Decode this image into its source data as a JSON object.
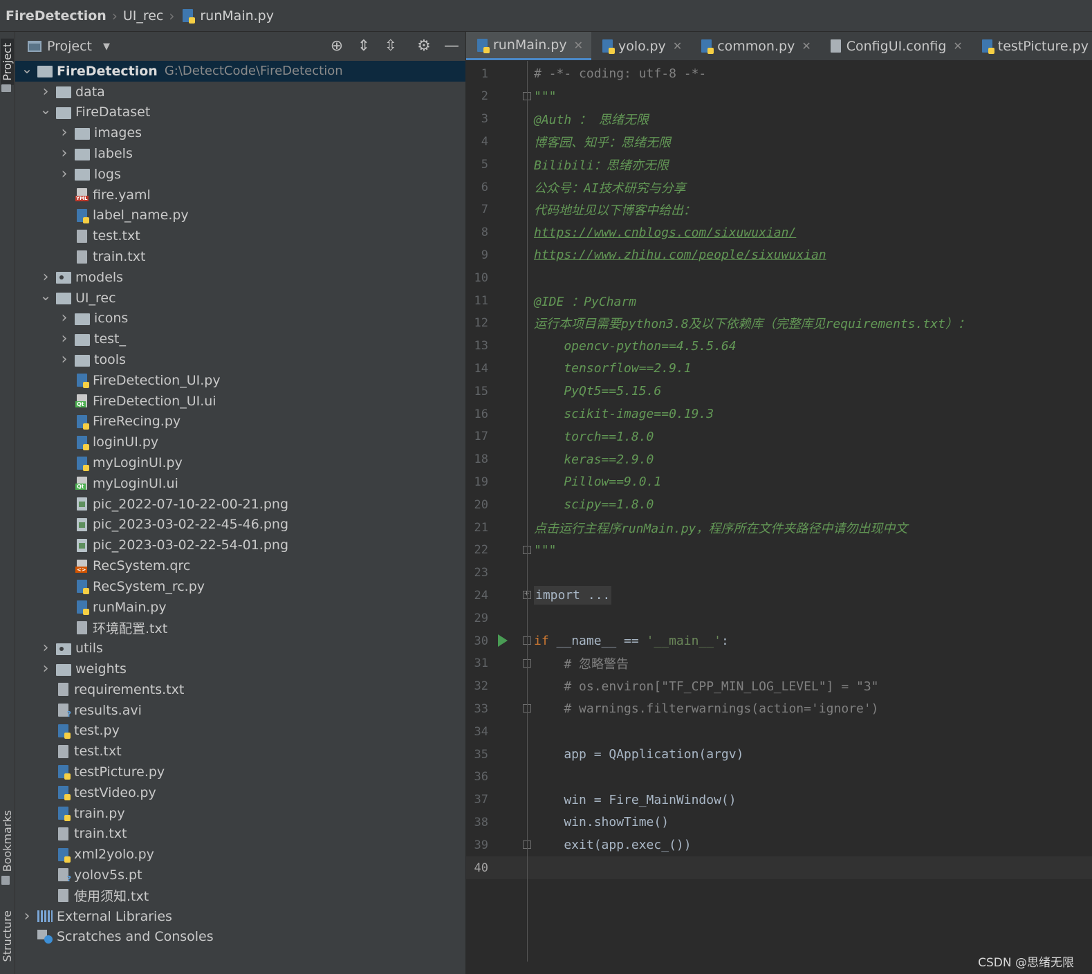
{
  "breadcrumb": {
    "root": "FireDetection",
    "folder": "UI_rec",
    "file": "runMain.py"
  },
  "side_labels": {
    "project": "Project",
    "bookmarks": "Bookmarks",
    "structure": "Structure"
  },
  "project_panel": {
    "title": "Project"
  },
  "tree": [
    {
      "label": "FireDetection",
      "path": "G:\\DetectCode\\FireDetection",
      "depth": 0,
      "kind": "folder",
      "arrow": "open",
      "selected": true,
      "bold": true
    },
    {
      "label": "data",
      "depth": 1,
      "kind": "folder",
      "arrow": "closed"
    },
    {
      "label": "FireDataset",
      "depth": 1,
      "kind": "folder",
      "arrow": "open"
    },
    {
      "label": "images",
      "depth": 2,
      "kind": "folder",
      "arrow": "closed"
    },
    {
      "label": "labels",
      "depth": 2,
      "kind": "folder",
      "arrow": "closed"
    },
    {
      "label": "logs",
      "depth": 2,
      "kind": "folder",
      "arrow": "closed"
    },
    {
      "label": "fire.yaml",
      "depth": 2,
      "kind": "yml"
    },
    {
      "label": "label_name.py",
      "depth": 2,
      "kind": "py"
    },
    {
      "label": "test.txt",
      "depth": 2,
      "kind": "txt"
    },
    {
      "label": "train.txt",
      "depth": 2,
      "kind": "txt"
    },
    {
      "label": "models",
      "depth": 1,
      "kind": "folder-dot",
      "arrow": "closed"
    },
    {
      "label": "UI_rec",
      "depth": 1,
      "kind": "folder",
      "arrow": "open"
    },
    {
      "label": "icons",
      "depth": 2,
      "kind": "folder",
      "arrow": "closed"
    },
    {
      "label": "test_",
      "depth": 2,
      "kind": "folder",
      "arrow": "closed"
    },
    {
      "label": "tools",
      "depth": 2,
      "kind": "folder",
      "arrow": "closed"
    },
    {
      "label": "FireDetection_UI.py",
      "depth": 2,
      "kind": "py"
    },
    {
      "label": "FireDetection_UI.ui",
      "depth": 2,
      "kind": "ui"
    },
    {
      "label": "FireRecing.py",
      "depth": 2,
      "kind": "py"
    },
    {
      "label": "loginUI.py",
      "depth": 2,
      "kind": "py"
    },
    {
      "label": "myLoginUI.py",
      "depth": 2,
      "kind": "py"
    },
    {
      "label": "myLoginUI.ui",
      "depth": 2,
      "kind": "ui"
    },
    {
      "label": "pic_2022-07-10-22-00-21.png",
      "depth": 2,
      "kind": "img"
    },
    {
      "label": "pic_2023-03-02-22-45-46.png",
      "depth": 2,
      "kind": "img"
    },
    {
      "label": "pic_2023-03-02-22-54-01.png",
      "depth": 2,
      "kind": "img"
    },
    {
      "label": "RecSystem.qrc",
      "depth": 2,
      "kind": "qrc"
    },
    {
      "label": "RecSystem_rc.py",
      "depth": 2,
      "kind": "py"
    },
    {
      "label": "runMain.py",
      "depth": 2,
      "kind": "py"
    },
    {
      "label": "环境配置.txt",
      "depth": 2,
      "kind": "txt"
    },
    {
      "label": "utils",
      "depth": 1,
      "kind": "folder-dot",
      "arrow": "closed"
    },
    {
      "label": "weights",
      "depth": 1,
      "kind": "folder",
      "arrow": "closed"
    },
    {
      "label": "requirements.txt",
      "depth": 1,
      "kind": "txt"
    },
    {
      "label": "results.avi",
      "depth": 1,
      "kind": "unk"
    },
    {
      "label": "test.py",
      "depth": 1,
      "kind": "py"
    },
    {
      "label": "test.txt",
      "depth": 1,
      "kind": "txt"
    },
    {
      "label": "testPicture.py",
      "depth": 1,
      "kind": "py"
    },
    {
      "label": "testVideo.py",
      "depth": 1,
      "kind": "py"
    },
    {
      "label": "train.py",
      "depth": 1,
      "kind": "py"
    },
    {
      "label": "train.txt",
      "depth": 1,
      "kind": "txt"
    },
    {
      "label": "xml2yolo.py",
      "depth": 1,
      "kind": "py"
    },
    {
      "label": "yolov5s.pt",
      "depth": 1,
      "kind": "unk"
    },
    {
      "label": "使用须知.txt",
      "depth": 1,
      "kind": "txt"
    },
    {
      "label": "External Libraries",
      "depth": 0,
      "kind": "lib",
      "arrow": "closed"
    },
    {
      "label": "Scratches and Consoles",
      "depth": 0,
      "kind": "scratch"
    }
  ],
  "tabs": [
    {
      "label": "runMain.py",
      "kind": "py",
      "active": true
    },
    {
      "label": "yolo.py",
      "kind": "py"
    },
    {
      "label": "common.py",
      "kind": "py"
    },
    {
      "label": "ConfigUI.config",
      "kind": "txt"
    },
    {
      "label": "testPicture.py",
      "kind": "py"
    }
  ],
  "code_lines": [
    {
      "n": "1",
      "parts": [
        {
          "t": "# -*- coding: utf-8 -*-",
          "c": "com"
        }
      ]
    },
    {
      "n": "2",
      "fold": "open",
      "parts": [
        {
          "t": "\"\"\"",
          "c": "doc"
        }
      ]
    },
    {
      "n": "3",
      "parts": [
        {
          "t": "@Auth ： 思绪无限",
          "c": "doc"
        }
      ]
    },
    {
      "n": "4",
      "parts": [
        {
          "t": "博客园、知乎：思绪无限",
          "c": "doc"
        }
      ]
    },
    {
      "n": "5",
      "parts": [
        {
          "t": "Bilibili：思绪亦无限",
          "c": "doc"
        }
      ]
    },
    {
      "n": "6",
      "parts": [
        {
          "t": "公众号：AI技术研究与分享",
          "c": "doc"
        }
      ]
    },
    {
      "n": "7",
      "parts": [
        {
          "t": "代码地址见以下博客中给出：",
          "c": "doc"
        }
      ]
    },
    {
      "n": "8",
      "parts": [
        {
          "t": "https://www.cnblogs.com/sixuwuxian/",
          "c": "url"
        }
      ]
    },
    {
      "n": "9",
      "parts": [
        {
          "t": "https://www.zhihu.com/people/sixuwuxian",
          "c": "url"
        }
      ]
    },
    {
      "n": "10",
      "parts": []
    },
    {
      "n": "11",
      "parts": [
        {
          "t": "@IDE ：PyCharm",
          "c": "doc"
        }
      ]
    },
    {
      "n": "12",
      "parts": [
        {
          "t": "运行本项目需要python3.8及以下依赖库（完整库见requirements.txt）：",
          "c": "doc"
        }
      ]
    },
    {
      "n": "13",
      "parts": [
        {
          "t": "    opencv-python==4.5.5.64",
          "c": "doc"
        }
      ]
    },
    {
      "n": "14",
      "parts": [
        {
          "t": "    tensorflow==2.9.1",
          "c": "doc"
        }
      ]
    },
    {
      "n": "15",
      "parts": [
        {
          "t": "    PyQt5==5.15.6",
          "c": "doc"
        }
      ]
    },
    {
      "n": "16",
      "parts": [
        {
          "t": "    scikit-image==0.19.3",
          "c": "doc"
        }
      ]
    },
    {
      "n": "17",
      "parts": [
        {
          "t": "    torch==1.8.0",
          "c": "doc"
        }
      ]
    },
    {
      "n": "18",
      "parts": [
        {
          "t": "    keras==2.9.0",
          "c": "doc"
        }
      ]
    },
    {
      "n": "19",
      "parts": [
        {
          "t": "    Pillow==9.0.1",
          "c": "doc"
        }
      ]
    },
    {
      "n": "20",
      "parts": [
        {
          "t": "    scipy==1.8.0",
          "c": "doc"
        }
      ]
    },
    {
      "n": "21",
      "parts": [
        {
          "t": "点击运行主程序runMain.py，程序所在文件夹路径中请勿出现中文",
          "c": "doc"
        }
      ]
    },
    {
      "n": "22",
      "fold": "close",
      "parts": [
        {
          "t": "\"\"\"",
          "c": "doc"
        }
      ]
    },
    {
      "n": "23",
      "parts": []
    },
    {
      "n": "24",
      "fold": "plus",
      "parts": [
        {
          "t": "import ...",
          "c": "fold"
        }
      ]
    },
    {
      "n": "29",
      "parts": []
    },
    {
      "n": "30",
      "run": true,
      "fold": "open",
      "parts": [
        {
          "t": "if",
          "c": "kw"
        },
        {
          "t": " __name__ == ",
          "c": "norm"
        },
        {
          "t": "'__main__'",
          "c": "str"
        },
        {
          "t": ":",
          "c": "norm"
        }
      ]
    },
    {
      "n": "31",
      "fold": "open",
      "parts": [
        {
          "t": "    # 忽略警告",
          "c": "com"
        }
      ]
    },
    {
      "n": "32",
      "parts": [
        {
          "t": "    # os.environ[\"TF_CPP_MIN_LOG_LEVEL\"] = \"3\"",
          "c": "com"
        }
      ]
    },
    {
      "n": "33",
      "fold": "close",
      "parts": [
        {
          "t": "    # warnings.filterwarnings(action='ignore')",
          "c": "com"
        }
      ]
    },
    {
      "n": "34",
      "parts": []
    },
    {
      "n": "35",
      "parts": [
        {
          "t": "    app = QApplication(argv)",
          "c": "norm"
        }
      ]
    },
    {
      "n": "36",
      "parts": []
    },
    {
      "n": "37",
      "parts": [
        {
          "t": "    win = Fire_MainWindow()",
          "c": "norm"
        }
      ]
    },
    {
      "n": "38",
      "parts": [
        {
          "t": "    win.showTime()",
          "c": "norm"
        }
      ]
    },
    {
      "n": "39",
      "fold": "close",
      "parts": [
        {
          "t": "    exit(app.exec_())",
          "c": "norm"
        }
      ]
    },
    {
      "n": "40",
      "current": true,
      "parts": []
    }
  ],
  "watermark": "CSDN @思绪无限",
  "icons": {
    "nav_file": "python-file-icon",
    "locate": "crosshair-icon",
    "expand": "expand-all-icon",
    "collapse": "collapse-all-icon",
    "settings": "gear-icon",
    "hide": "minus-icon"
  }
}
